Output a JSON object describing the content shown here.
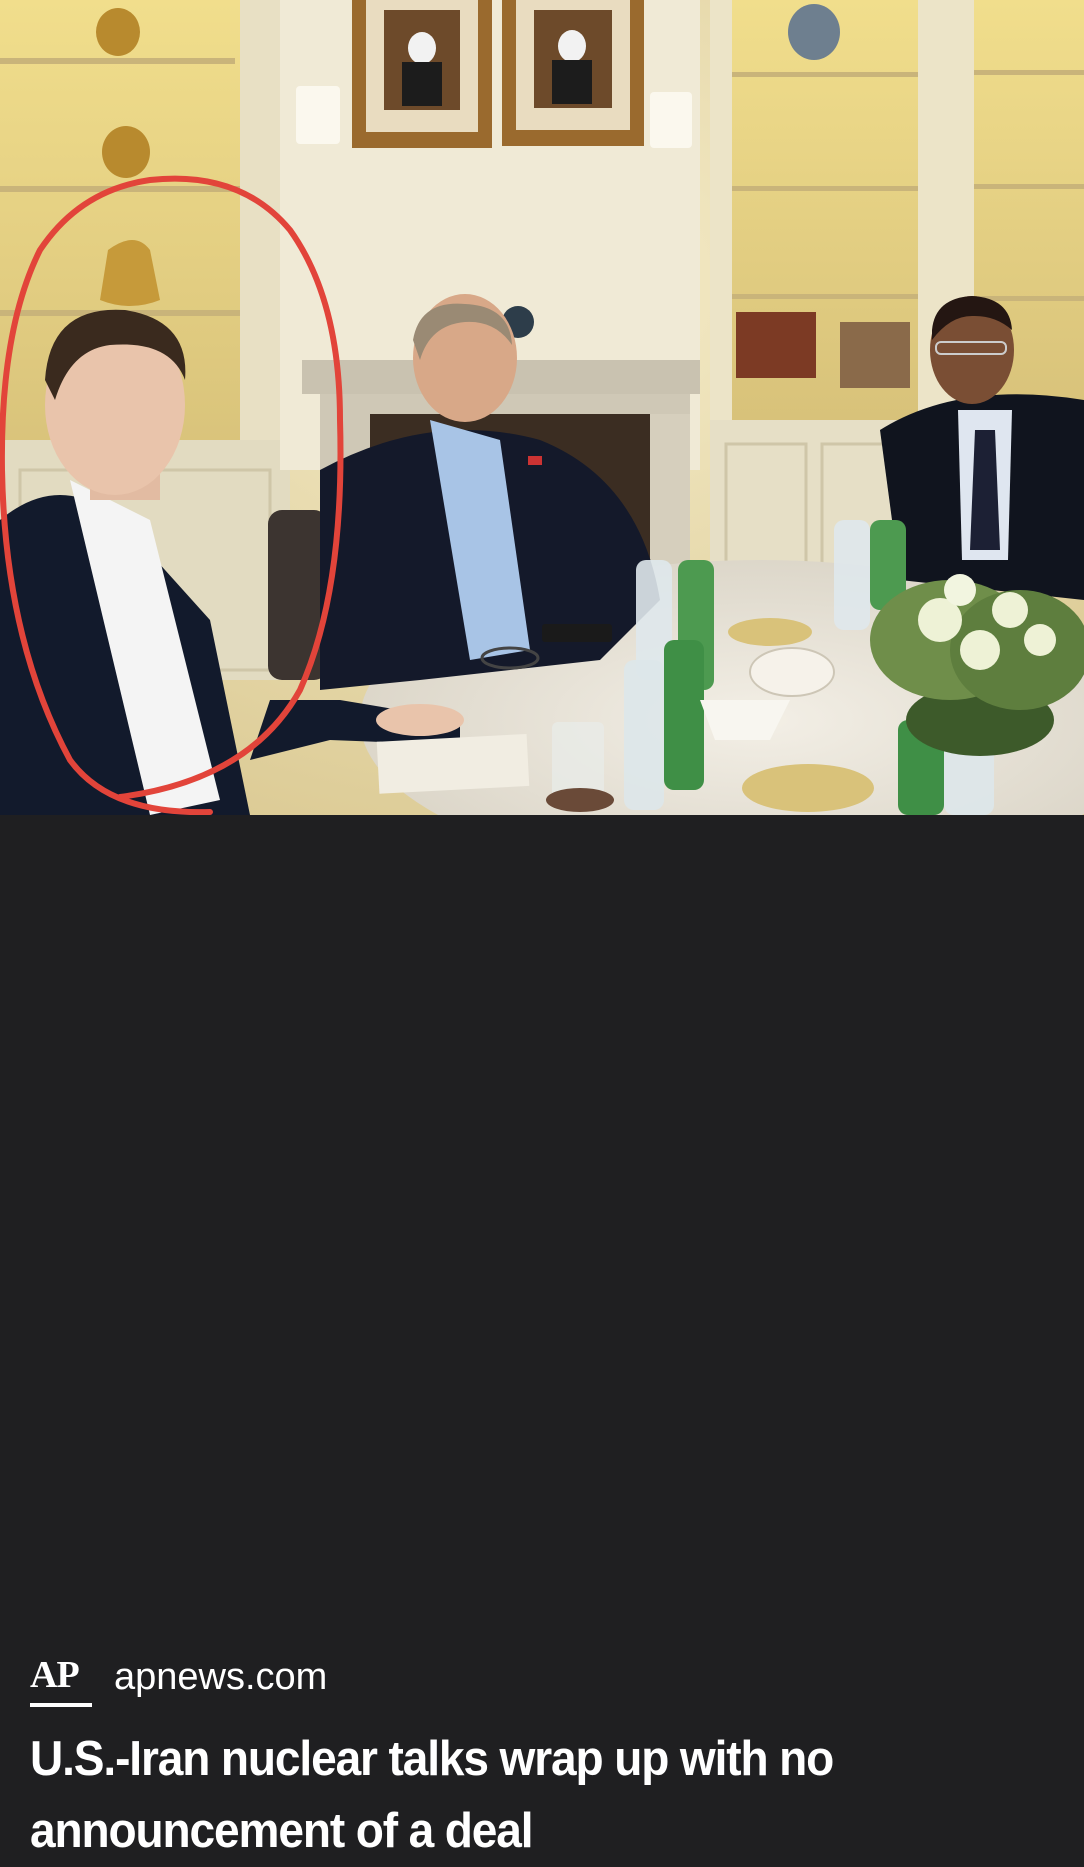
{
  "article_card": {
    "source": {
      "logo_text": "AP",
      "domain": "apnews.com"
    },
    "headline": "U.S.-Iran nuclear talks wrap up with no announcement of a deal",
    "annotation_color": "#e2443a"
  }
}
